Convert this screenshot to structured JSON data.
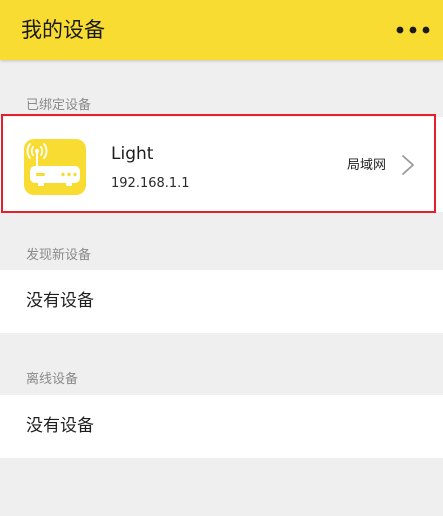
{
  "app_bar": {
    "title": "我的设备",
    "more_icon": "more-horizontal-icon"
  },
  "colors": {
    "accent": "#f8dc31",
    "background": "#efefef",
    "highlight": "#e5202a"
  },
  "sections": {
    "bound": {
      "title": "已绑定设备",
      "devices": [
        {
          "icon": "router-icon",
          "name": "Light",
          "ip": "192.168.1.1",
          "network": "局域网",
          "arrow_icon": "chevron-right-icon"
        }
      ]
    },
    "discovered": {
      "title": "发现新设备",
      "empty_text": "没有设备"
    },
    "offline": {
      "title": "离线设备",
      "empty_text": "没有设备"
    }
  }
}
